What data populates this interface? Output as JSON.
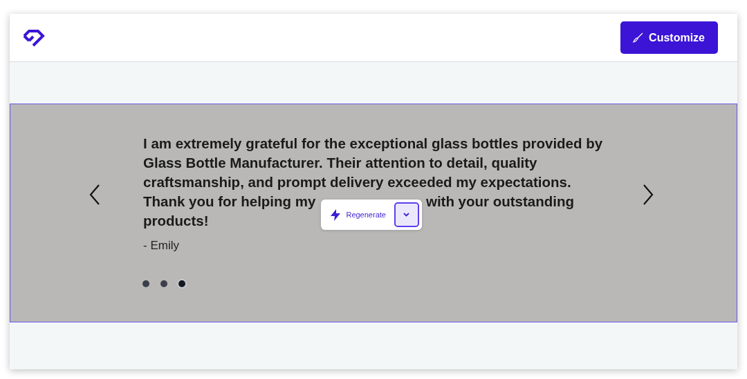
{
  "header": {
    "button": "Customize"
  },
  "testimonial": {
    "lines_above": [
      "I am extremely grateful for the exceptional glass bottles provided by",
      "Glass Bottle Manufacturer. Their attention to detail, quality",
      "craftsmanship, and prompt delivery exceeded my expectations."
    ],
    "line_start": "Thank you for helping my",
    "line_end": "with your outstanding",
    "lines_below": [
      "products!"
    ],
    "author": "- Emily",
    "dots": [
      {
        "selected": false
      },
      {
        "selected": false
      },
      {
        "selected": true
      }
    ]
  },
  "popup": {
    "button": "Regenerate"
  }
}
